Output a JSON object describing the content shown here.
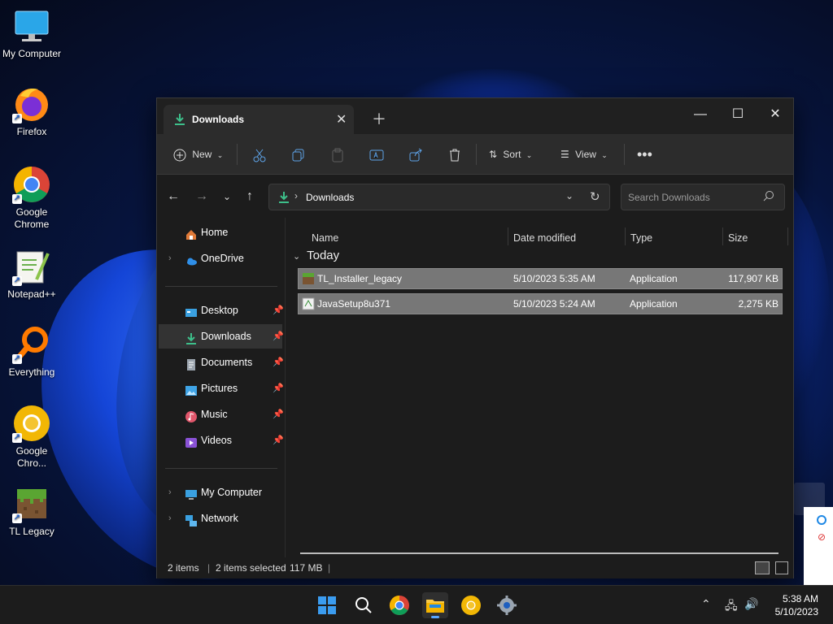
{
  "desktop": {
    "icons": [
      {
        "label": "My Computer",
        "icon": "monitor-icon"
      },
      {
        "label": "Firefox",
        "icon": "firefox-icon"
      },
      {
        "label": "Google Chrome",
        "icon": "chrome-icon"
      },
      {
        "label": "Notepad++",
        "icon": "notepad-plus-plus-icon"
      },
      {
        "label": "Everything",
        "icon": "everything-search-icon"
      },
      {
        "label": "Google Chro...",
        "icon": "chrome-canary-icon"
      },
      {
        "label": "TL Legacy",
        "icon": "grass-block-icon"
      }
    ]
  },
  "window": {
    "tab_title": "Downloads",
    "toolbar": {
      "new_label": "New",
      "sort_label": "Sort",
      "view_label": "View"
    },
    "address": {
      "crumb": "Downloads",
      "search_placeholder": "Search Downloads"
    },
    "sidebar": {
      "top": [
        {
          "label": "Home",
          "icon": "home-icon"
        },
        {
          "label": "OneDrive",
          "icon": "onedrive-icon"
        }
      ],
      "quick": [
        {
          "label": "Desktop",
          "icon": "desktop-folder-icon"
        },
        {
          "label": "Downloads",
          "icon": "downloads-folder-icon"
        },
        {
          "label": "Documents",
          "icon": "documents-folder-icon"
        },
        {
          "label": "Pictures",
          "icon": "pictures-folder-icon"
        },
        {
          "label": "Music",
          "icon": "music-folder-icon"
        },
        {
          "label": "Videos",
          "icon": "videos-folder-icon"
        }
      ],
      "bottom": [
        {
          "label": "My Computer",
          "icon": "computer-icon"
        },
        {
          "label": "Network",
          "icon": "network-icon"
        }
      ]
    },
    "columns": [
      "Name",
      "Date modified",
      "Type",
      "Size"
    ],
    "group_label": "Today",
    "files": [
      {
        "name": "TL_Installer_legacy",
        "date": "5/10/2023 5:35 AM",
        "type": "Application",
        "size": "117,907 KB",
        "icon": "grass-block-icon"
      },
      {
        "name": "JavaSetup8u371",
        "date": "5/10/2023 5:24 AM",
        "type": "Application",
        "size": "2,275 KB",
        "icon": "java-setup-icon"
      }
    ],
    "status": {
      "items": "2 items",
      "selected": "2 items selected",
      "size": "117 MB"
    }
  },
  "taskbar": {
    "time": "5:38 AM",
    "date": "5/10/2023"
  },
  "colors": {
    "accent": "#1f8f5f",
    "selection": "#777777",
    "window_bg": "#1c1c1c"
  }
}
